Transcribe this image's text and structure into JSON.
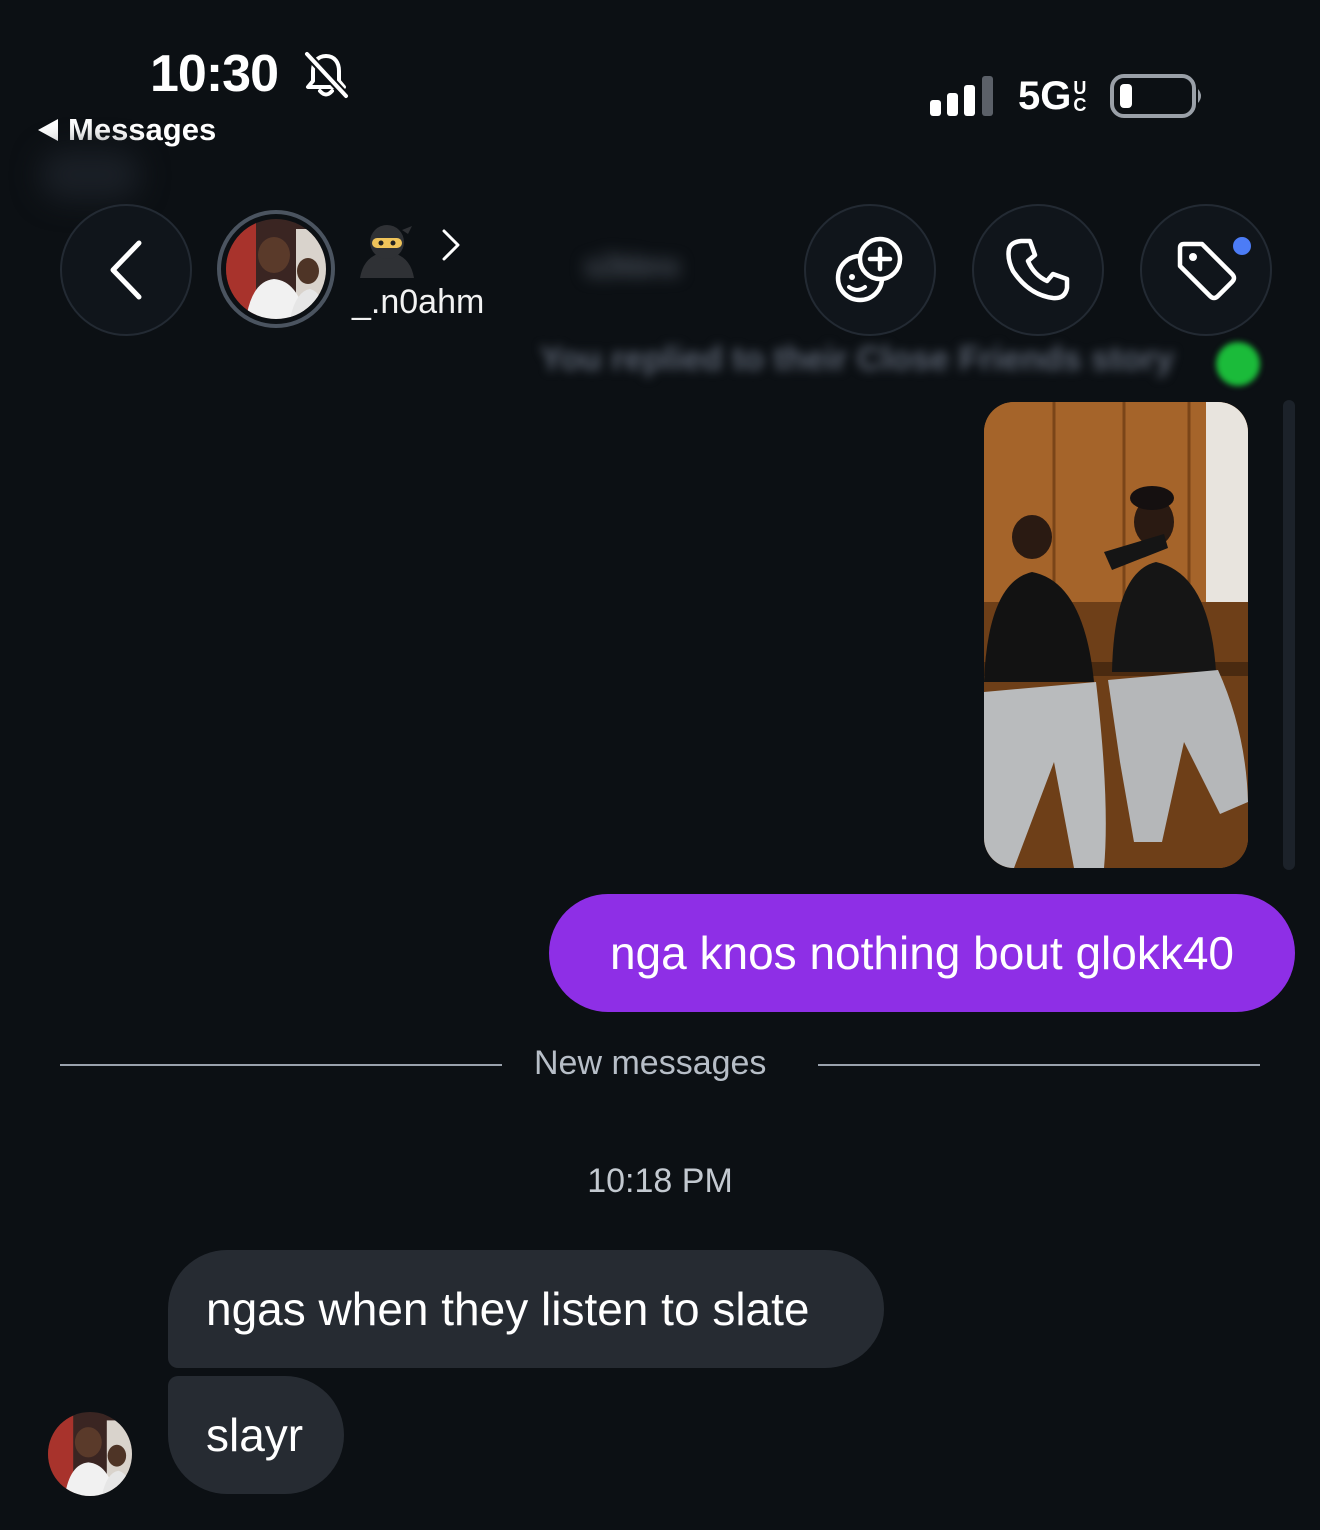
{
  "status_bar": {
    "time": "10:30",
    "network": "5G",
    "network_suffix": [
      "U",
      "C"
    ],
    "back_app_label": "Messages"
  },
  "header": {
    "username": "_.n0ahm",
    "blurred_name": "s2kbnx",
    "story_reply_note": "You replied to their Close Friends story"
  },
  "thread": {
    "outgoing_message": "nga knos nothing bout glokk40",
    "divider_label": "New messages",
    "timestamp": "10:18 PM",
    "incoming_messages": [
      "ngas when they listen to slate",
      "slayr"
    ]
  },
  "colors": {
    "background": "#0c1014",
    "outgoing_bubble": "#8e2fe6",
    "incoming_bubble": "#262b32",
    "notification_dot": "#4c7cf6",
    "close_friends": "#1bbb3a"
  },
  "icons": {
    "back": "chevron-left-icon",
    "effects": "face-plus-icon",
    "call": "phone-icon",
    "tag": "tag-icon",
    "silent": "bell-slash-icon"
  }
}
